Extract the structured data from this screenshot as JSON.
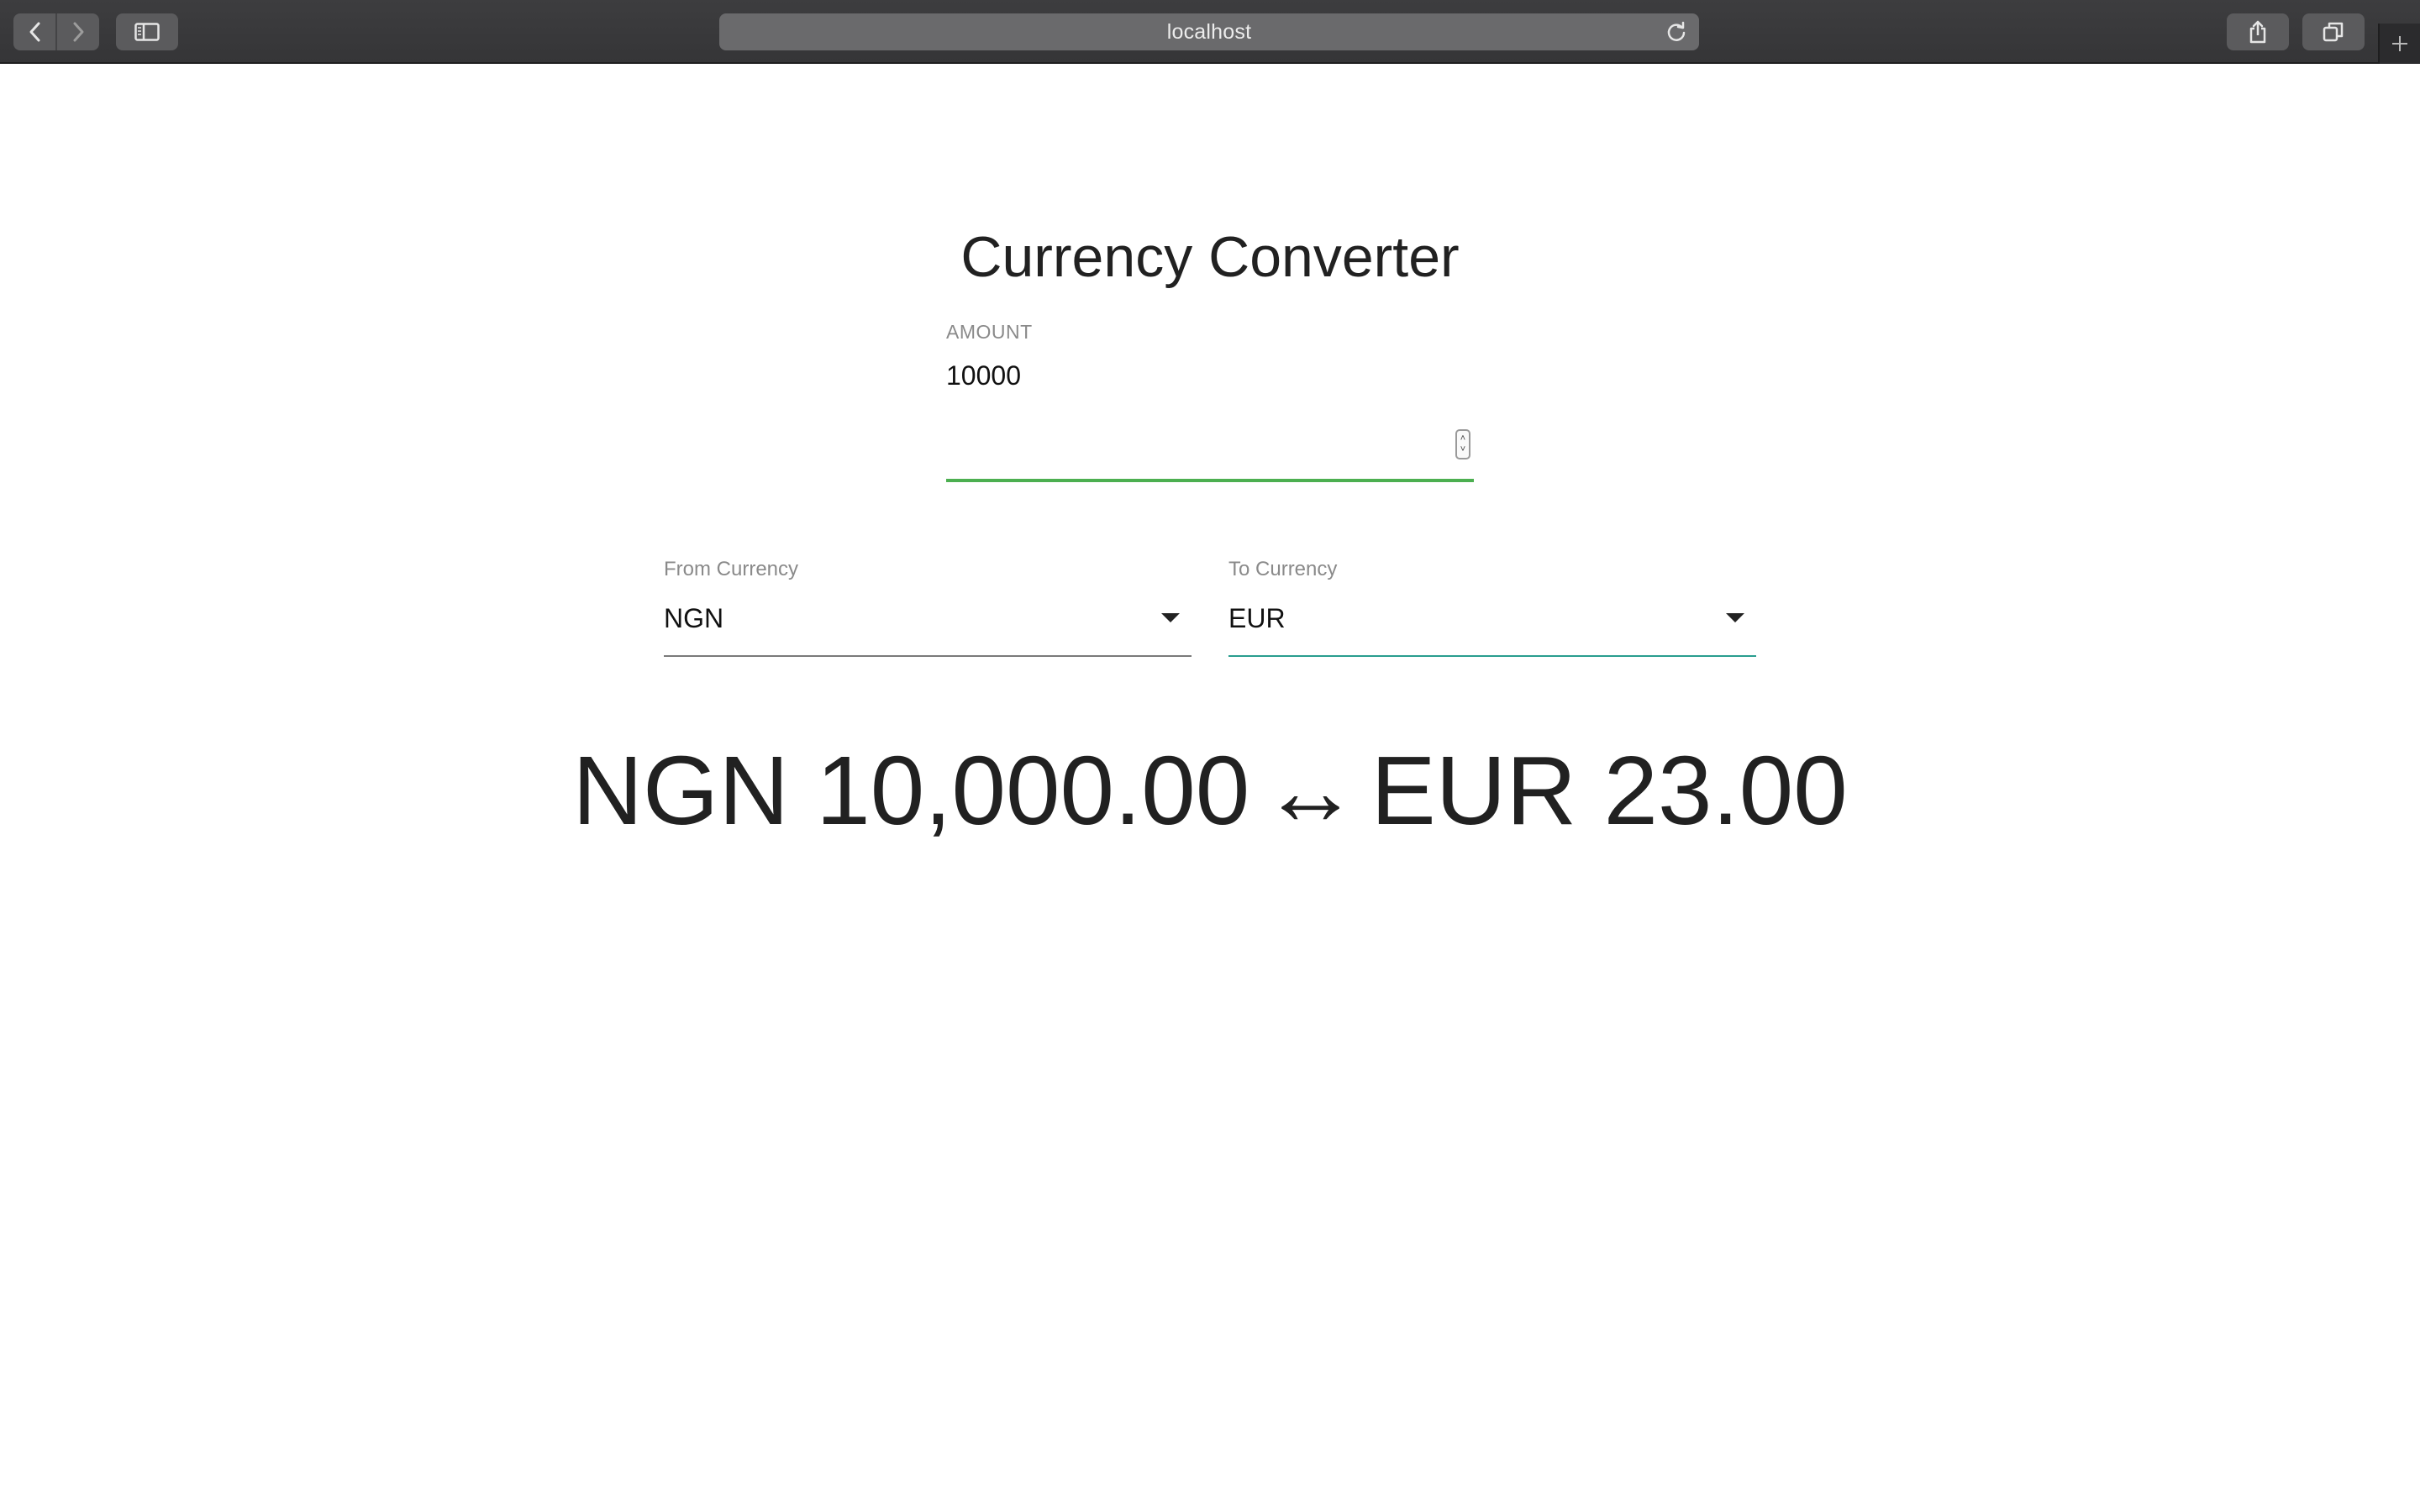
{
  "browser": {
    "address": "localhost"
  },
  "page": {
    "title": "Currency Converter",
    "amount": {
      "label": "AMOUNT",
      "value": "10000"
    },
    "from_currency": {
      "label": "From Currency",
      "value": "NGN"
    },
    "to_currency": {
      "label": "To Currency",
      "value": "EUR"
    },
    "result": {
      "from_code": "NGN",
      "from_amount": "10,000.00",
      "arrow": "↔",
      "to_code": "EUR",
      "to_amount": "23.00"
    }
  },
  "colors": {
    "amount_focus": "#4caf50",
    "to_currency_underline": "#2a9d8f",
    "from_currency_underline": "#7a7a7a"
  }
}
